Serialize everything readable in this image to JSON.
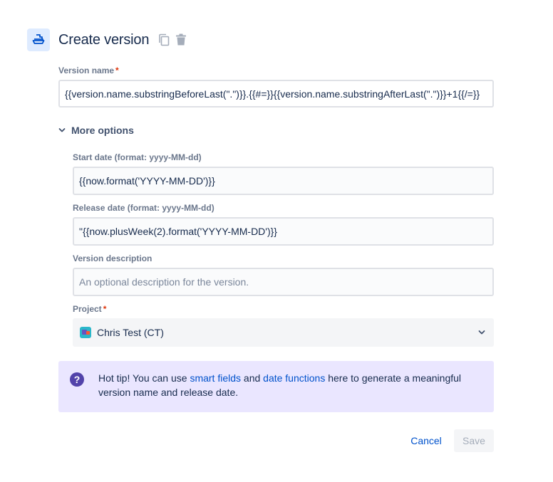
{
  "header": {
    "title": "Create version",
    "icons": [
      "ship-icon",
      "copy-icon",
      "trash-icon"
    ]
  },
  "form": {
    "version_name": {
      "label": "Version name",
      "required_marker": "*",
      "value": "{{version.name.substringBeforeLast(\".\")}}.{{#=}}{{version.name.substringAfterLast(\".\")}}+1{{/=}}"
    },
    "more_options": {
      "label": "More options",
      "icon": "chevron-down-icon"
    },
    "start_date": {
      "label": "Start date (format: yyyy-MM-dd)",
      "value": "{{now.format('YYYY-MM-DD')}}"
    },
    "release_date": {
      "label": "Release date (format: yyyy-MM-dd)",
      "value": "\"{{now.plusWeek(2).format('YYYY-MM-DD')}}"
    },
    "version_description": {
      "label": "Version description",
      "placeholder": "An optional description for the version."
    },
    "project": {
      "label": "Project",
      "required_marker": "*",
      "value": "Chris Test (CT)"
    }
  },
  "tip": {
    "icon": "question-circle-icon",
    "prefix": "Hot tip! You can use ",
    "link1": "smart fields",
    "mid": " and ",
    "link2": "date functions",
    "suffix": " here to generate a meaningful version name and release date.",
    "link_color": "#0052cc",
    "background": "#eae6ff"
  },
  "actions": {
    "cancel_label": "Cancel",
    "save_label": "Save"
  },
  "colors": {
    "accent": "#0052cc",
    "required": "#de350b",
    "header_icon_bg": "#deebff"
  }
}
